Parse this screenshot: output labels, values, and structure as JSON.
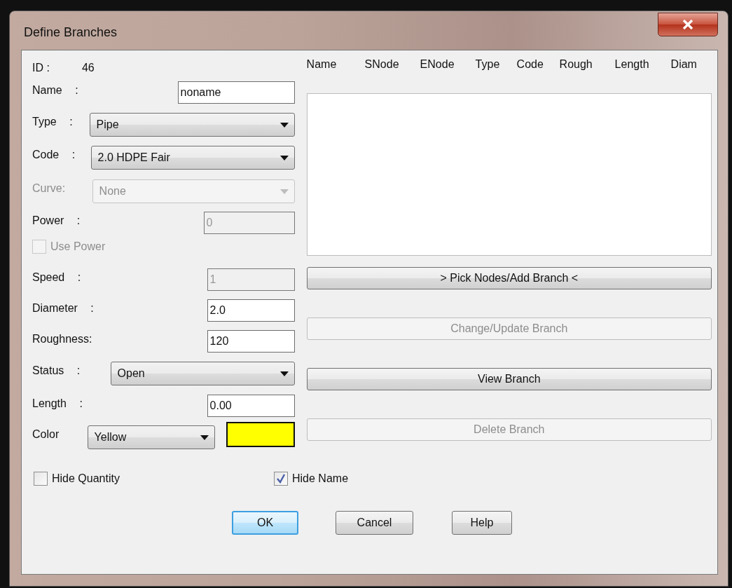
{
  "window": {
    "title": "Define Branches"
  },
  "id": {
    "label": "ID :",
    "value": "46"
  },
  "fields": [
    {
      "kind": "text",
      "label": "Name :",
      "value": "noname",
      "disabled": false
    },
    {
      "kind": "select",
      "label": "Type :",
      "value": "Pipe",
      "disabled": false
    },
    {
      "kind": "select",
      "label": "Code :",
      "value": "2.0 HDPE Fair",
      "disabled": false
    },
    {
      "kind": "select",
      "label": "Curve:",
      "value": "None",
      "disabled": true
    },
    {
      "kind": "text",
      "label": "Power :",
      "value": "0",
      "disabled": true
    },
    {
      "kind": "checkbox",
      "label": "Use Power",
      "checked": false,
      "disabled": true
    },
    {
      "kind": "text",
      "label": "Speed :",
      "value": "1",
      "disabled": true
    },
    {
      "kind": "text",
      "label": "Diameter :",
      "value": "2.0",
      "disabled": false
    },
    {
      "kind": "text",
      "label": "Roughness:",
      "value": "120",
      "disabled": false
    },
    {
      "kind": "select",
      "label": "Status :",
      "value": "Open",
      "disabled": false
    },
    {
      "kind": "text",
      "label": "Length :",
      "value": "0.00",
      "disabled": false
    },
    {
      "kind": "color",
      "label": "Color",
      "value": "Yellow",
      "color": "#ffff00",
      "disabled": false
    }
  ],
  "branch_list": {
    "columns": [
      "Name",
      "SNode",
      "ENode",
      "Type",
      "Code",
      "Rough",
      "Length",
      "Diam"
    ]
  },
  "actions": [
    {
      "label": "> Pick Nodes/Add Branch <",
      "disabled": false
    },
    {
      "label": "Change/Update Branch",
      "disabled": true
    },
    {
      "label": "View Branch",
      "disabled": false
    },
    {
      "label": "Delete Branch",
      "disabled": true
    }
  ],
  "options": [
    {
      "label": "Hide Quantity",
      "checked": false
    },
    {
      "label": "Hide Name",
      "checked": true
    }
  ],
  "buttons": [
    {
      "label": "OK",
      "default": true
    },
    {
      "label": "Cancel",
      "default": false
    },
    {
      "label": "Help",
      "default": false
    }
  ]
}
